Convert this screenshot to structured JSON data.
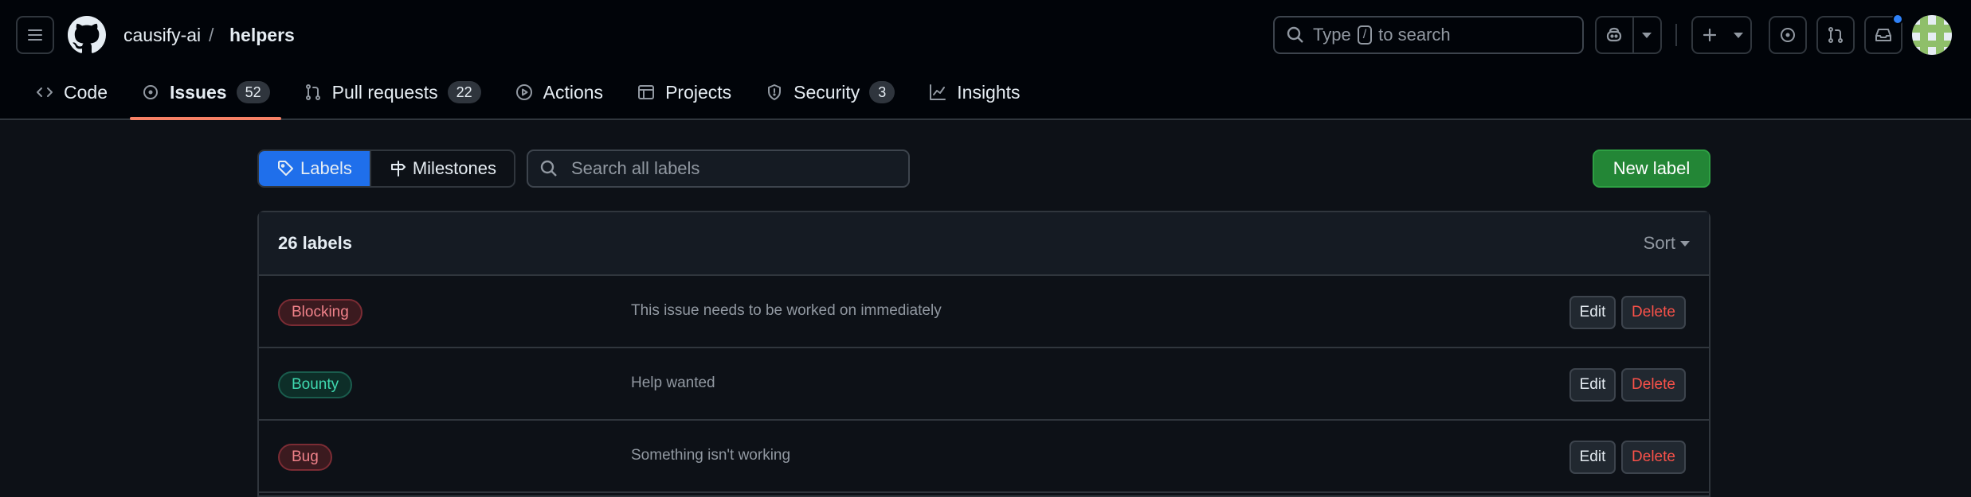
{
  "header": {
    "owner": "causify-ai",
    "separator": "/",
    "repo": "helpers",
    "search_prefix": "Type",
    "search_key": "/",
    "search_suffix": "to search"
  },
  "tabs": [
    {
      "label": "Code",
      "icon": "code-icon",
      "count": null
    },
    {
      "label": "Issues",
      "icon": "issue-opened-icon",
      "count": "52",
      "active": true
    },
    {
      "label": "Pull requests",
      "icon": "git-pull-request-icon",
      "count": "22"
    },
    {
      "label": "Actions",
      "icon": "play-icon",
      "count": null
    },
    {
      "label": "Projects",
      "icon": "table-icon",
      "count": null
    },
    {
      "label": "Security",
      "icon": "shield-icon",
      "count": "3"
    },
    {
      "label": "Insights",
      "icon": "graph-icon",
      "count": null
    }
  ],
  "subnav": {
    "labels": "Labels",
    "milestones": "Milestones",
    "search_placeholder": "Search all labels",
    "new_label": "New label"
  },
  "labels_box": {
    "title": "26 labels",
    "sort": "Sort",
    "edit": "Edit",
    "delete": "Delete",
    "rows": [
      {
        "name": "Blocking",
        "description": "This issue needs to be worked on immediately",
        "text_color": "#f0828a",
        "bg_color": "#3b1a1f",
        "border_color": "#7b2c34"
      },
      {
        "name": "Bounty",
        "description": "Help wanted",
        "text_color": "#3fd9b0",
        "bg_color": "#0d2e28",
        "border_color": "#1a5c4d"
      },
      {
        "name": "Bug",
        "description": "Something isn't working",
        "text_color": "#f0828a",
        "bg_color": "#3b1a1f",
        "border_color": "#7b2c34"
      }
    ]
  },
  "colors": {
    "accent_blue": "#1f6feb",
    "primary_green": "#238636",
    "tab_underline": "#f78166",
    "danger": "#f85149"
  }
}
